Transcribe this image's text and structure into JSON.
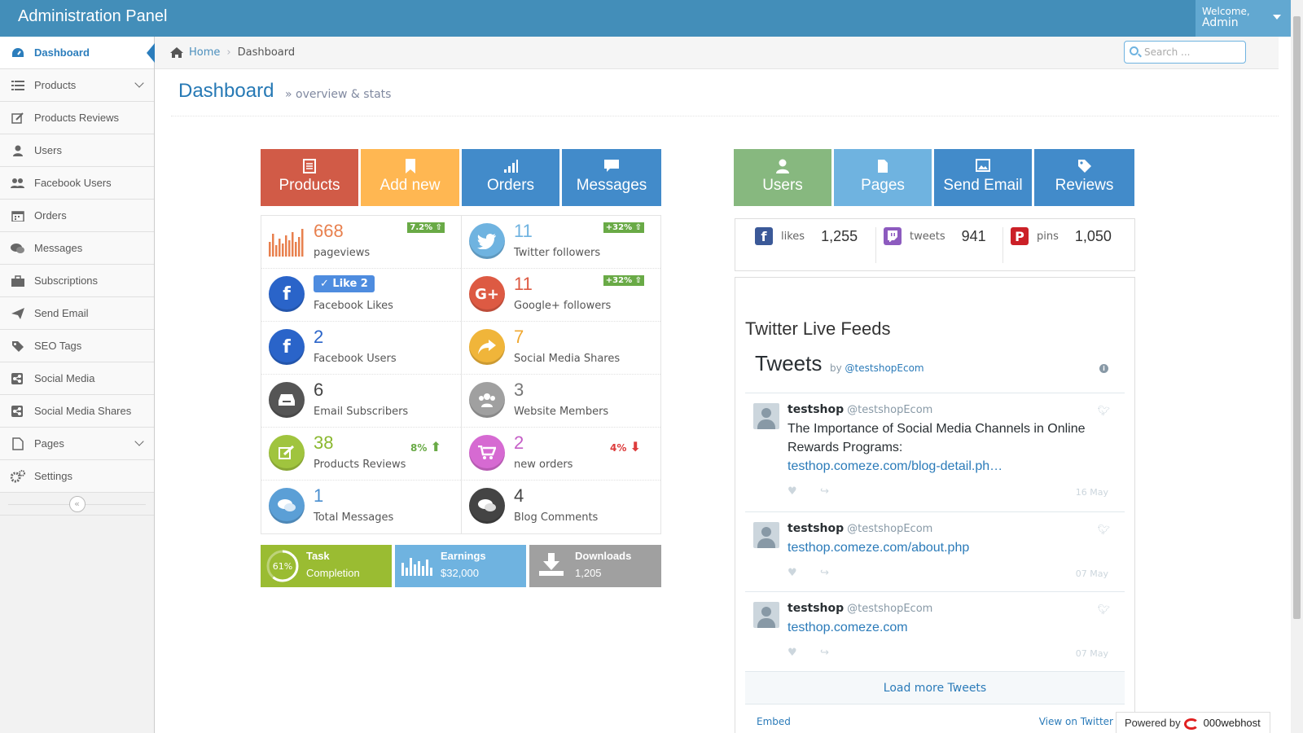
{
  "app": {
    "title": "Administration Panel",
    "welcome": "Welcome,",
    "user": "Admin"
  },
  "sidebar": {
    "items": [
      {
        "label": "Dashboard",
        "icon": "dashboard-icon",
        "active": true
      },
      {
        "label": "Products",
        "icon": "list-icon",
        "has_submenu": true
      },
      {
        "label": "Products Reviews",
        "icon": "edit-icon"
      },
      {
        "label": "Users",
        "icon": "user-icon"
      },
      {
        "label": "Facebook Users",
        "icon": "users-icon"
      },
      {
        "label": "Orders",
        "icon": "calendar-icon"
      },
      {
        "label": "Messages",
        "icon": "comments-icon"
      },
      {
        "label": "Subscriptions",
        "icon": "briefcase-icon"
      },
      {
        "label": "Send Email",
        "icon": "send-icon"
      },
      {
        "label": "SEO Tags",
        "icon": "tag-icon"
      },
      {
        "label": "Social Media",
        "icon": "share-icon"
      },
      {
        "label": "Social Media Shares",
        "icon": "share-icon"
      },
      {
        "label": "Pages",
        "icon": "file-icon",
        "has_submenu": true
      },
      {
        "label": "Settings",
        "icon": "cogs-icon"
      }
    ]
  },
  "breadcrumb": {
    "home": "Home",
    "current": "Dashboard"
  },
  "search": {
    "placeholder": "Search ..."
  },
  "page": {
    "title": "Dashboard",
    "subtitle": "» overview & stats"
  },
  "shortcuts_left": [
    {
      "label": "Products",
      "color": "#d15b47",
      "icon": "list-alt-icon"
    },
    {
      "label": "Add new",
      "color": "#ffb752",
      "icon": "bookmark-icon"
    },
    {
      "label": "Orders",
      "color": "#428bca",
      "icon": "signal-icon"
    },
    {
      "label": "Messages",
      "color": "#428bca",
      "icon": "comment-icon"
    }
  ],
  "shortcuts_right": [
    {
      "label": "Users",
      "color": "#87b87f",
      "icon": "user-icon"
    },
    {
      "label": "Pages",
      "color": "#6fb3e0",
      "icon": "file-icon"
    },
    {
      "label": "Send Email",
      "color": "#428bca",
      "icon": "picture-icon"
    },
    {
      "label": "Reviews",
      "color": "#428bca",
      "icon": "tag-icon"
    }
  ],
  "stats": {
    "pageviews": {
      "value": "668",
      "label": "pageviews",
      "badge": "7.2%"
    },
    "twitter": {
      "value": "11",
      "label": "Twitter followers",
      "badge": "+32%"
    },
    "fb_likes": {
      "button": "Like 2",
      "label": "Facebook Likes"
    },
    "google": {
      "value": "11",
      "label": "Google+ followers",
      "badge": "+32%"
    },
    "fb_users": {
      "value": "2",
      "label": "Facebook Users"
    },
    "shares": {
      "value": "7",
      "label": "Social Media Shares"
    },
    "subscribers": {
      "value": "6",
      "label": "Email Subscribers"
    },
    "members": {
      "value": "3",
      "label": "Website Members"
    },
    "reviews": {
      "value": "38",
      "label": "Products Reviews",
      "pct": "8%"
    },
    "new_orders": {
      "value": "2",
      "label": "new orders",
      "pct": "4%"
    },
    "messages": {
      "value": "1",
      "label": "Total Messages"
    },
    "blog": {
      "value": "4",
      "label": "Blog Comments"
    }
  },
  "infoboxes": {
    "task": {
      "title": "Task",
      "subtitle": "Completion",
      "percent": "61%"
    },
    "earnings": {
      "title": "Earnings",
      "value": "$32,000"
    },
    "downloads": {
      "title": "Downloads",
      "value": "1,205"
    }
  },
  "social": {
    "likes": {
      "label": "likes",
      "value": "1,255"
    },
    "tweets": {
      "label": "tweets",
      "value": "941"
    },
    "pins": {
      "label": "pins",
      "value": "1,050"
    }
  },
  "twitter_feed": {
    "section_title": "Twitter Live Feeds",
    "header": "Tweets",
    "by": "by",
    "handle": "@testshopEcom",
    "tweets": [
      {
        "name": "testshop",
        "handle": "@testshopEcom",
        "text": "The Importance of Social Media Channels in Online Rewards Programs:",
        "link": "testhop.comeze.com/blog-detail.ph…",
        "date": "16 May"
      },
      {
        "name": "testshop",
        "handle": "@testshopEcom",
        "text": "",
        "link": "testhop.comeze.com/about.php",
        "date": "07 May"
      },
      {
        "name": "testshop",
        "handle": "@testshopEcom",
        "text": "",
        "link": "testhop.comeze.com",
        "date": "07 May"
      }
    ],
    "load_more": "Load more Tweets",
    "embed": "Embed",
    "view_on": "View on Twitter"
  },
  "powered": {
    "label": "Powered by",
    "brand": "000webhost"
  }
}
